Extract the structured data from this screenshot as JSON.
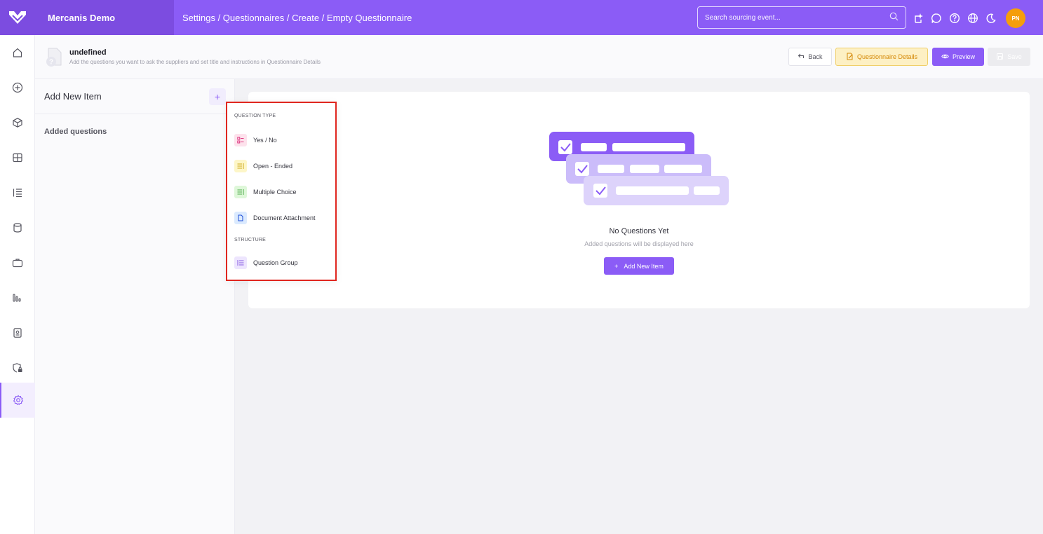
{
  "app": {
    "brand": "Mercanis Demo",
    "breadcrumb": "Settings / Questionnaires / Create / Empty Questionnaire"
  },
  "search": {
    "placeholder": "Search sourcing event..."
  },
  "user": {
    "initials": "PN"
  },
  "subheader": {
    "title": "undefined",
    "description": "Add the questions you want to ask the suppliers and set title and instructions in Questionnaire Details",
    "back_label": "Back",
    "details_label": "Questionnaire Details",
    "preview_label": "Preview",
    "save_label": "Save"
  },
  "left_panel": {
    "title": "Add New Item",
    "plus": "+",
    "added_label": "Added questions"
  },
  "dropdown": {
    "question_type_label": "QUESTION TYPE",
    "items": [
      {
        "label": "Yes / No"
      },
      {
        "label": "Open - Ended"
      },
      {
        "label": "Multiple Choice"
      },
      {
        "label": "Document Attachment"
      }
    ],
    "structure_label": "STRUCTURE",
    "structure_items": [
      {
        "label": "Question Group"
      }
    ]
  },
  "empty_state": {
    "title": "No Questions Yet",
    "subtitle": "Added questions will be displayed here",
    "button_label": "Add New Item",
    "button_icon": "+"
  },
  "colors": {
    "accent": "#8b5cf6",
    "brand_dark": "#7c4ce0",
    "highlight_border": "#e0261f",
    "warning_bg": "#fdf0c4",
    "warning_text": "#d48806"
  }
}
